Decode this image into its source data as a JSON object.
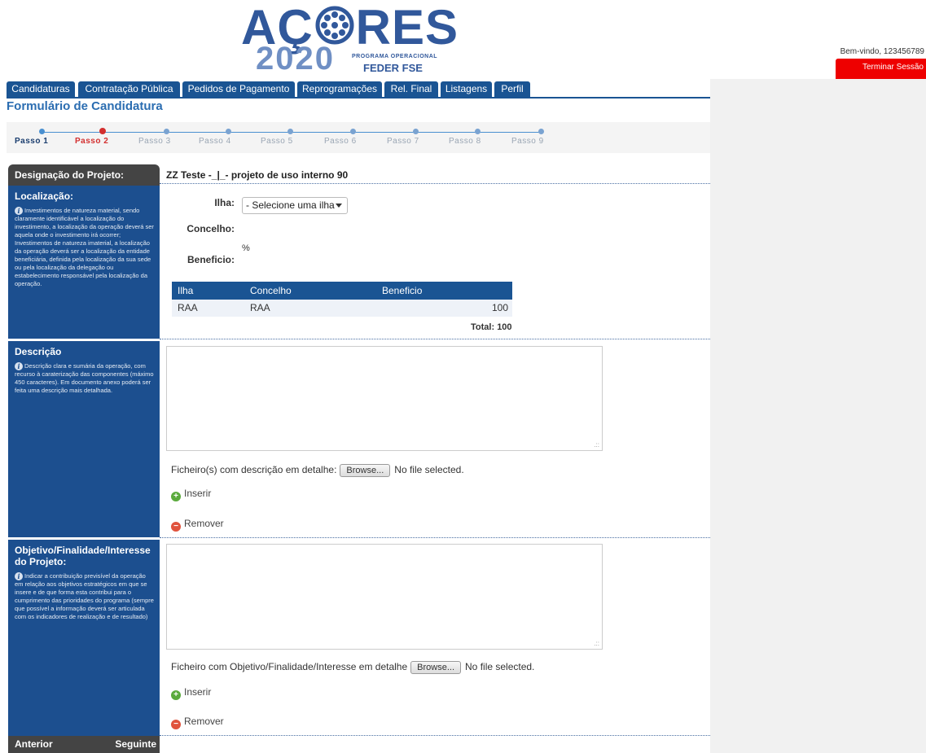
{
  "header": {
    "logo_top_left": "AÇ",
    "logo_top_right": "RES",
    "logo_year": "2020",
    "logo_program": "PROGRAMA OPERACIONAL",
    "logo_funds": "FEDER FSE",
    "welcome": "Bem-vindo, 123456789",
    "logout_label": "Terminar Sessão"
  },
  "tabs": [
    "Candidaturas",
    "Contratação Pública",
    "Pedidos de Pagamento",
    "Reprogramações",
    "Rel. Final",
    "Listagens",
    "Perfil"
  ],
  "page_title": "Formulário de Candidatura",
  "steps": [
    "Passo 1",
    "Passo 2",
    "Passo 3",
    "Passo 4",
    "Passo 5",
    "Passo 6",
    "Passo 7",
    "Passo 8",
    "Passo 9"
  ],
  "colors": {
    "primary_blue": "#1a5493",
    "dark_header": "#444444",
    "logout_red": "#ee0000",
    "current_step": "#d32f2f"
  },
  "designacao": {
    "label": "Designação do Projeto:",
    "value": "ZZ Teste -_|_- projeto de uso interno 90"
  },
  "localizacao": {
    "title": "Localização:",
    "help": "Investimentos de natureza material, sendo claramente identificável a localização do investimento, a localização da operação deverá ser aquela onde o investimento irá ocorrer; Investimentos de natureza imaterial, a localização da operação deverá ser a localização da entidade beneficiária, definida pela localização da sua sede ou pela localização da delegação ou estabelecimento responsável pela localização da operação.",
    "ilha_label": "Ilha:",
    "ilha_select": "- Selecione uma ilha -",
    "concelho_label": "Concelho:",
    "beneficio_label": "Beneficio:",
    "percent": "%",
    "table": {
      "headers": [
        "Ilha",
        "Concelho",
        "Beneficio"
      ],
      "rows": [
        [
          "RAA",
          "RAA",
          "100"
        ]
      ],
      "total_label": "Total:",
      "total_value": "100"
    }
  },
  "descricao": {
    "title": "Descrição",
    "help": "Descrição clara e sumária da operação, com recurso à caraterização das componentes (máximo 450 caracteres). Em documento anexo poderá ser feita uma descrição mais detalhada.",
    "textarea_value": "",
    "file_label": "Ficheiro(s) com descrição em detalhe:",
    "browse": "Browse...",
    "no_file": "No file selected.",
    "insert": "Inserir",
    "remove": "Remover"
  },
  "objetivo": {
    "title": "Objetivo/Finalidade/Interesse do Projeto:",
    "help": "Indicar a contribuição previsível da operação em relação aos objetivos estratégicos em que se insere e de que forma esta contribui para o cumprimento das prioridades do programa (sempre que possível a informação deverá ser articulada com os indicadores de realização e de resultado)",
    "textarea_value": "",
    "file_label": "Ficheiro com Objetivo/Finalidade/Interesse em detalhe",
    "browse": "Browse...",
    "no_file": "No file selected.",
    "insert": "Inserir",
    "remove": "Remover"
  },
  "footer_nav": {
    "previous": "Anterior",
    "next": "Seguinte"
  }
}
